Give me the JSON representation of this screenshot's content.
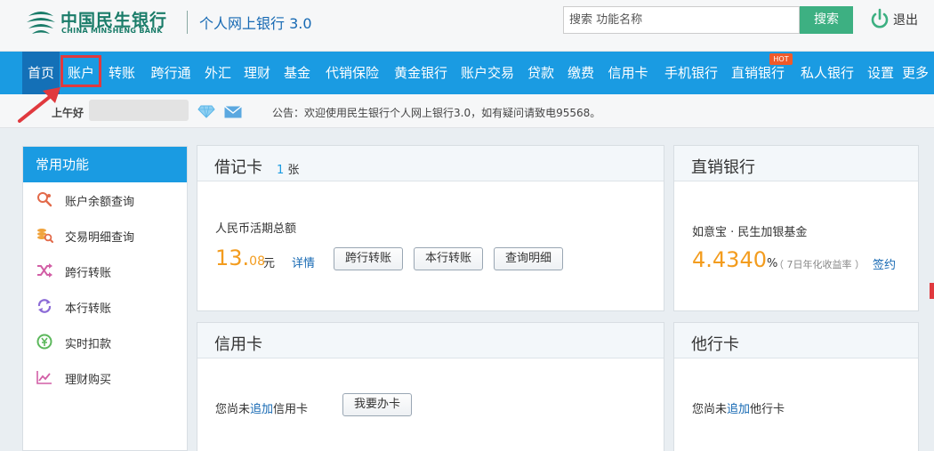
{
  "header": {
    "logo_cn": "中国民生银行",
    "logo_en": "CHINA MINSHENG BANK",
    "site_title": "个人网上银行 3.0",
    "search_placeholder": "搜索 功能名称",
    "search_button": "搜索",
    "logout": "退出",
    "brand_color": "#1a7c69"
  },
  "nav": {
    "items": [
      "首页",
      "账户",
      "转账",
      "跨行通",
      "外汇",
      "理财",
      "基金",
      "代销保险",
      "黄金银行",
      "账户交易",
      "贷款",
      "缴费",
      "信用卡",
      "手机银行",
      "直销银行",
      "私人银行",
      "设置",
      "更多"
    ],
    "hot_badge": "HOT",
    "bar_color": "#1a9be2"
  },
  "greet_bar": {
    "greeting": "上午好",
    "notice": "公告：欢迎使用民生银行个人网上银行3.0，如有疑问请致电95568。"
  },
  "quick": {
    "title": "常用功能",
    "items": [
      {
        "label": "账户余额查询",
        "icon": "balance-search-icon"
      },
      {
        "label": "交易明细查询",
        "icon": "coins-search-icon"
      },
      {
        "label": "跨行转账",
        "icon": "shuffle-icon"
      },
      {
        "label": "本行转账",
        "icon": "cycle-icon"
      },
      {
        "label": "实时扣款",
        "icon": "money-icon"
      },
      {
        "label": "理财购买",
        "icon": "chart-icon"
      }
    ]
  },
  "debit": {
    "title": "借记卡",
    "count": "1",
    "count_unit": "张",
    "label": "人民币活期总额",
    "amount_int": "13.",
    "amount_dec": "08",
    "unit": "元",
    "detail": "详情",
    "btn_cross": "跨行转账",
    "btn_internal": "本行转账",
    "btn_query": "查询明细"
  },
  "direct": {
    "title": "直销银行",
    "product": "如意宝 · 民生加银基金",
    "rate": "4.4340",
    "rate_sym": "%",
    "rate_note": "（ 7日年化收益率 ）",
    "sign": "签约"
  },
  "credit": {
    "title": "信用卡",
    "text_before": "您尚未",
    "text_link": "追加",
    "text_after": "信用卡",
    "btn_apply": "我要办卡"
  },
  "other": {
    "title": "他行卡",
    "text_before": "您尚未",
    "text_link": "追加",
    "text_after": "他行卡"
  }
}
